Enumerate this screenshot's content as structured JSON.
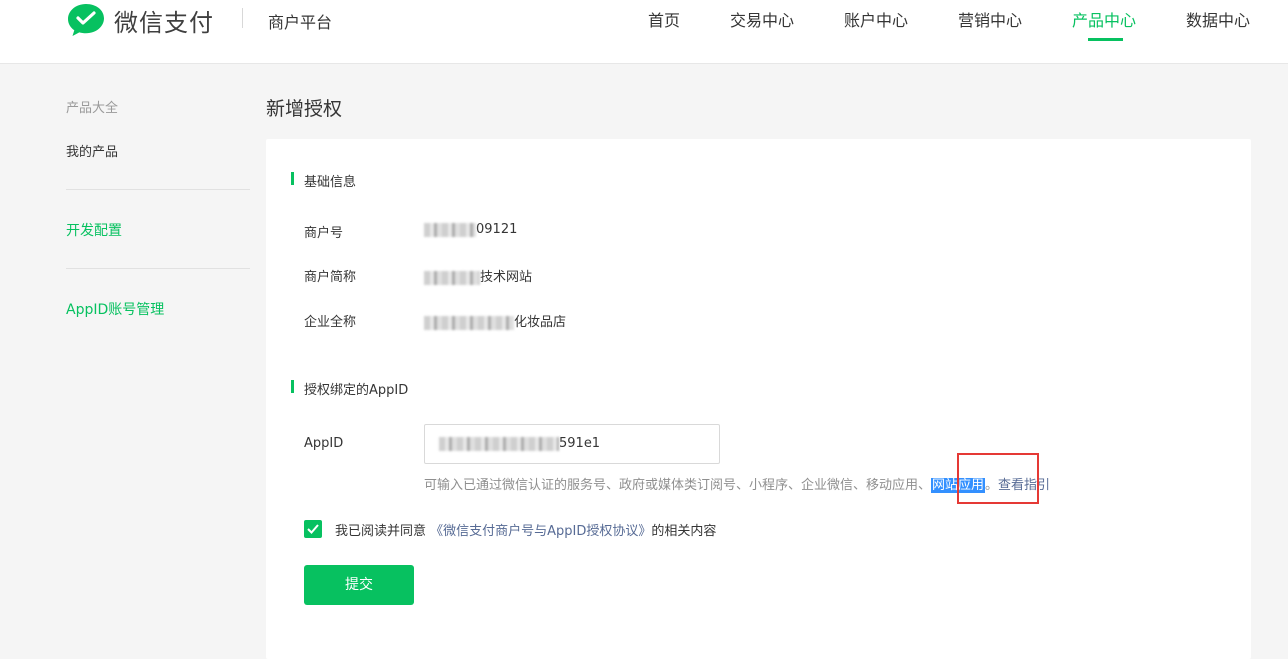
{
  "header": {
    "logo_text": "微信支付",
    "platform": "商户平台",
    "nav": [
      {
        "label": "首页"
      },
      {
        "label": "交易中心"
      },
      {
        "label": "账户中心"
      },
      {
        "label": "营销中心"
      },
      {
        "label": "产品中心"
      },
      {
        "label": "数据中心"
      }
    ],
    "active_nav": "产品中心"
  },
  "sidebar": {
    "group_title": "产品大全",
    "my_products": "我的产品",
    "dev_config": "开发配置",
    "appid_manage": "AppID账号管理"
  },
  "main": {
    "page_title": "新增授权",
    "basic_section": "基础信息",
    "merchant_no_label": "商户号",
    "merchant_no_value": "09121",
    "short_name_label": "商户简称",
    "short_name_value": "技术网站",
    "full_name_label": "企业全称",
    "full_name_value": "化妆品店",
    "appid_section": "授权绑定的AppID",
    "appid_label": "AppID",
    "appid_value": "591e1",
    "hint_text": "可输入已通过微信认证的服务号、政府或媒体类订阅号、小程序、企业微信、移动应用、",
    "hint_highlight": "网站应用",
    "hint_period": "。",
    "hint_link": "查看指引",
    "agree_prefix": "我已阅读并同意",
    "agree_link": "《微信支付商户号与AppID授权协议》",
    "agree_suffix": "的相关内容",
    "agree_checked": true,
    "submit_label": "提交"
  },
  "colors": {
    "brand_green": "#07c160",
    "link_blue": "#576b95",
    "highlight_blue": "#3390ff",
    "annotation_red": "#e53935"
  }
}
